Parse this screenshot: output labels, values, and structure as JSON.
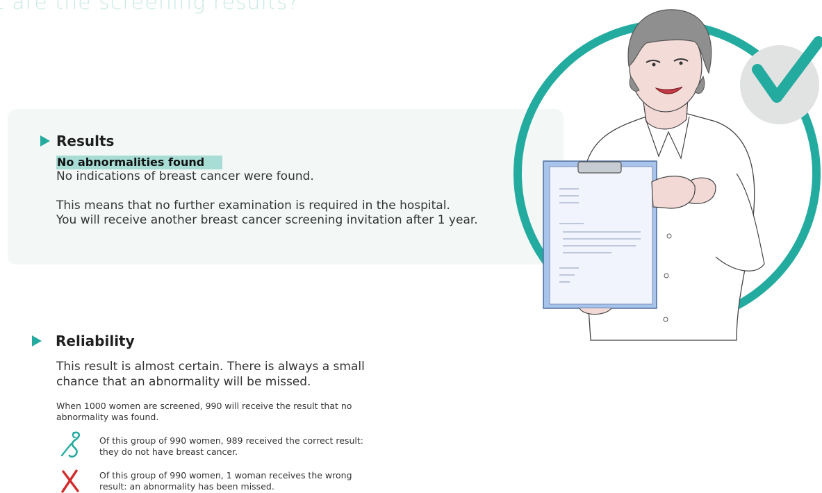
{
  "page": {
    "heading": "t are the screening results?"
  },
  "results": {
    "title": "Results",
    "highlight": "No abnormalities found",
    "indication": "No indications of breast cancer were found.",
    "means_line1": "This means that no further examination is required in the hospital.",
    "means_line2": "You will receive another breast cancer screening invitation after 1 year."
  },
  "reliability": {
    "title": "Reliability",
    "almost_certain": "This result is almost certain. There is always a small chance that an abnormality will be missed.",
    "screened": "When 1000 women are screened, 990 will receive the result that no abnormality was found.",
    "correct": "Of this group of 990 women, 989 received the correct result: they do not have breast cancer.",
    "wrong": "Of this group of 990 women, 1 woman receives the wrong result: an abnormality has been missed."
  },
  "icons": {
    "arrow": "play-triangle-icon",
    "correct": "woman-figure-icon",
    "wrong": "cross-icon",
    "check": "check-icon"
  },
  "colors": {
    "accent": "#24aba0",
    "highlight": "#a8ddd5",
    "panel": "#f3f8f6",
    "heading": "#c9e9e4",
    "wrong": "#d32a2a"
  }
}
